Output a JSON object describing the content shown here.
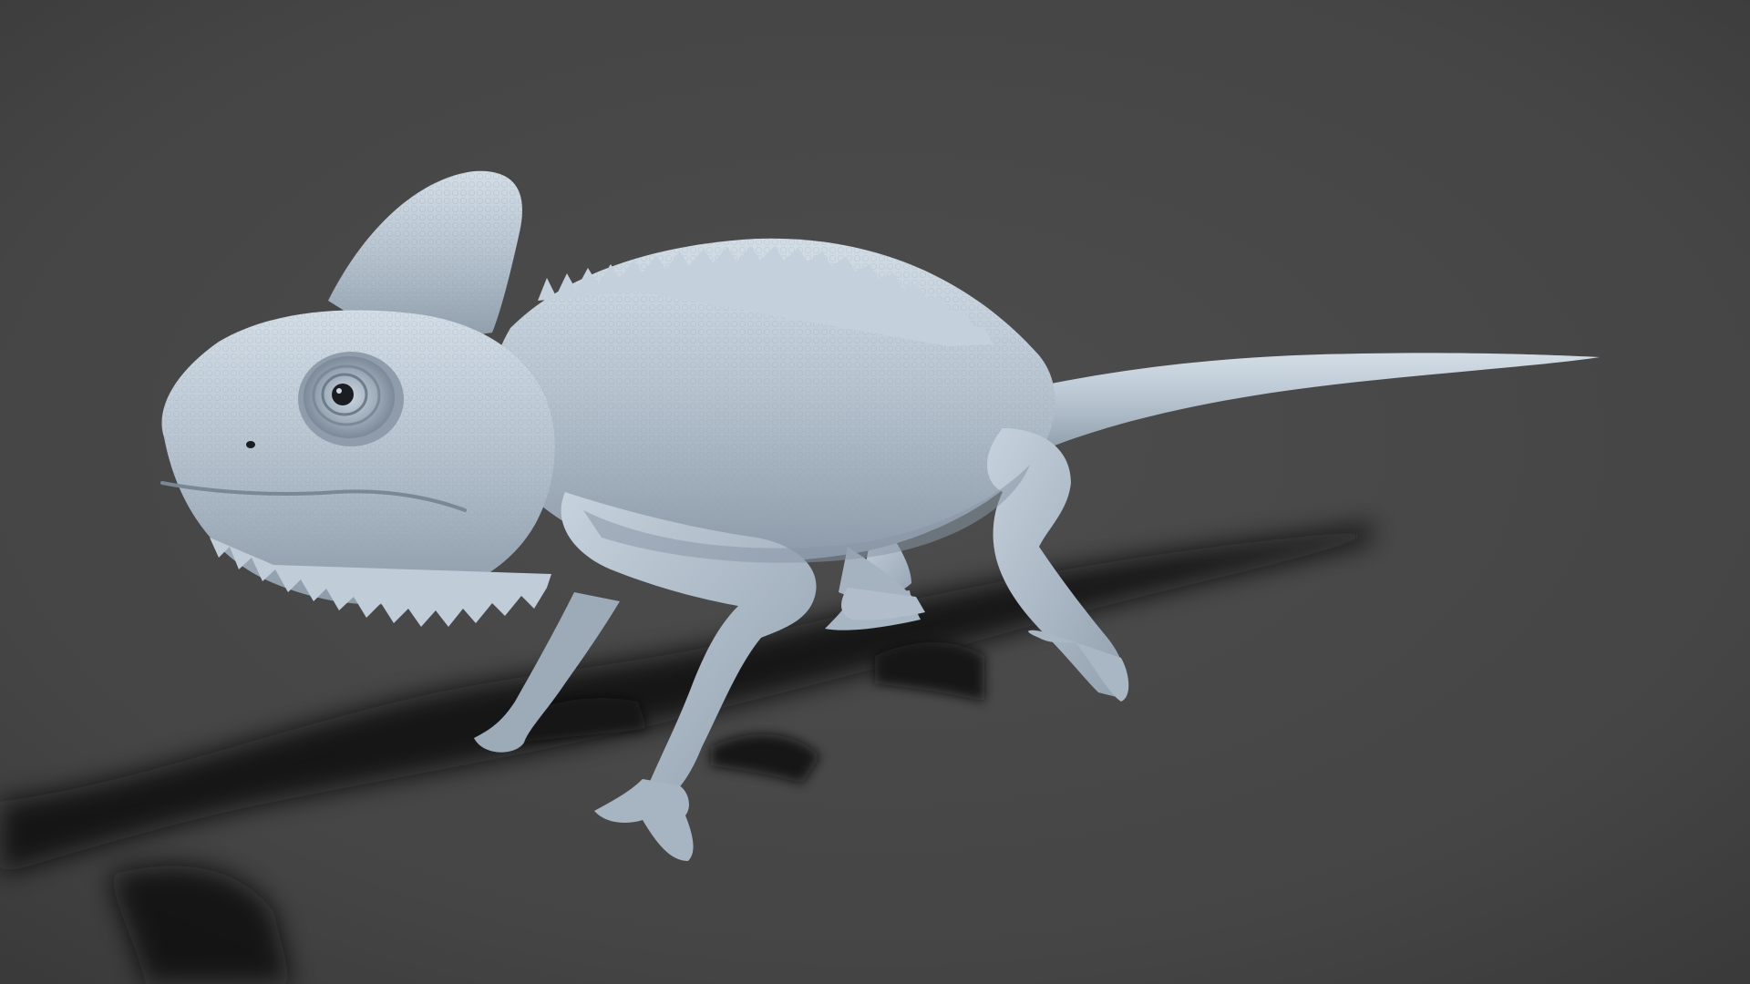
{
  "scene": {
    "subject": "chameleon-sculpt",
    "background_color": "#474747",
    "vignette_color": "#2f2f2f",
    "model_color": "#b9c6d2",
    "model_shade_color": "#8e9cab",
    "model_highlight_color": "#d9e2ea",
    "shadow_color": "#0e0e0e",
    "eye_color": "#1a1d21"
  }
}
